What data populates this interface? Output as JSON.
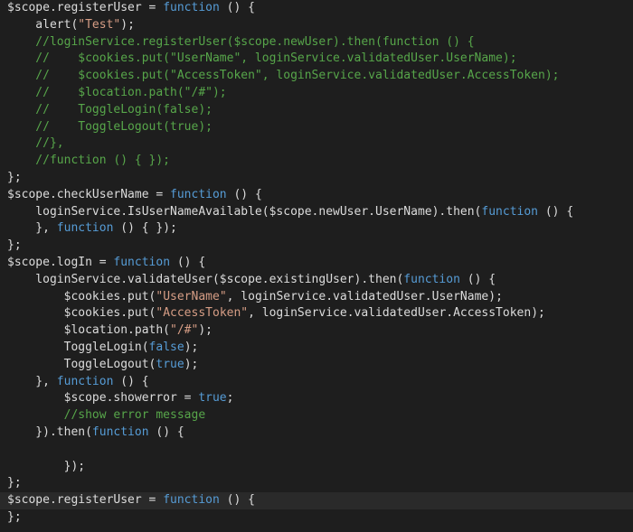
{
  "editor": {
    "background": "#1e1e1e",
    "current_line_background": "#2a2a2a",
    "current_line": 29,
    "colors": {
      "plain": "#dcdcdc",
      "keyword": "#569cd6",
      "string": "#d69d85",
      "comment": "#57a64a"
    },
    "lines": [
      [
        [
          "plain",
          "$scope.registerUser = "
        ],
        [
          "kw",
          "function"
        ],
        [
          "plain",
          " () {"
        ]
      ],
      [
        [
          "plain",
          "    alert("
        ],
        [
          "str",
          "\"Test\""
        ],
        [
          "plain",
          ");"
        ]
      ],
      [
        [
          "cmt",
          "    //loginService.registerUser($scope.newUser).then(function () {"
        ]
      ],
      [
        [
          "cmt",
          "    //    $cookies.put(\"UserName\", loginService.validatedUser.UserName);"
        ]
      ],
      [
        [
          "cmt",
          "    //    $cookies.put(\"AccessToken\", loginService.validatedUser.AccessToken);"
        ]
      ],
      [
        [
          "cmt",
          "    //    $location.path(\"/#\");"
        ]
      ],
      [
        [
          "cmt",
          "    //    ToggleLogin(false);"
        ]
      ],
      [
        [
          "cmt",
          "    //    ToggleLogout(true);"
        ]
      ],
      [
        [
          "cmt",
          "    //},"
        ]
      ],
      [
        [
          "cmt",
          "    //function () { });"
        ]
      ],
      [
        [
          "plain",
          "};"
        ]
      ],
      [
        [
          "plain",
          "$scope.checkUserName = "
        ],
        [
          "kw",
          "function"
        ],
        [
          "plain",
          " () {"
        ]
      ],
      [
        [
          "plain",
          "    loginService.IsUserNameAvailable($scope.newUser.UserName).then("
        ],
        [
          "kw",
          "function"
        ],
        [
          "plain",
          " () {"
        ]
      ],
      [
        [
          "plain",
          "    }, "
        ],
        [
          "kw",
          "function"
        ],
        [
          "plain",
          " () { });"
        ]
      ],
      [
        [
          "plain",
          "};"
        ]
      ],
      [
        [
          "plain",
          "$scope.logIn = "
        ],
        [
          "kw",
          "function"
        ],
        [
          "plain",
          " () {"
        ]
      ],
      [
        [
          "plain",
          "    loginService.validateUser($scope.existingUser).then("
        ],
        [
          "kw",
          "function"
        ],
        [
          "plain",
          " () {"
        ]
      ],
      [
        [
          "plain",
          "        $cookies.put("
        ],
        [
          "str",
          "\"UserName\""
        ],
        [
          "plain",
          ", loginService.validatedUser.UserName);"
        ]
      ],
      [
        [
          "plain",
          "        $cookies.put("
        ],
        [
          "str",
          "\"AccessToken\""
        ],
        [
          "plain",
          ", loginService.validatedUser.AccessToken);"
        ]
      ],
      [
        [
          "plain",
          "        $location.path("
        ],
        [
          "str",
          "\"/#\""
        ],
        [
          "plain",
          ");"
        ]
      ],
      [
        [
          "plain",
          "        ToggleLogin("
        ],
        [
          "kw",
          "false"
        ],
        [
          "plain",
          ");"
        ]
      ],
      [
        [
          "plain",
          "        ToggleLogout("
        ],
        [
          "kw",
          "true"
        ],
        [
          "plain",
          ");"
        ]
      ],
      [
        [
          "plain",
          "    }, "
        ],
        [
          "kw",
          "function"
        ],
        [
          "plain",
          " () {"
        ]
      ],
      [
        [
          "plain",
          "        $scope.showerror = "
        ],
        [
          "kw",
          "true"
        ],
        [
          "plain",
          ";"
        ]
      ],
      [
        [
          "cmt",
          "        //show error message"
        ]
      ],
      [
        [
          "plain",
          "    }).then("
        ],
        [
          "kw",
          "function"
        ],
        [
          "plain",
          " () {"
        ]
      ],
      [
        [
          "plain",
          ""
        ]
      ],
      [
        [
          "plain",
          "        });"
        ]
      ],
      [
        [
          "plain",
          "};"
        ]
      ],
      [
        [
          "plain",
          "$scope.registerUser = "
        ],
        [
          "kw",
          "function"
        ],
        [
          "plain",
          " () {"
        ]
      ],
      [
        [
          "plain",
          "};"
        ]
      ]
    ]
  }
}
